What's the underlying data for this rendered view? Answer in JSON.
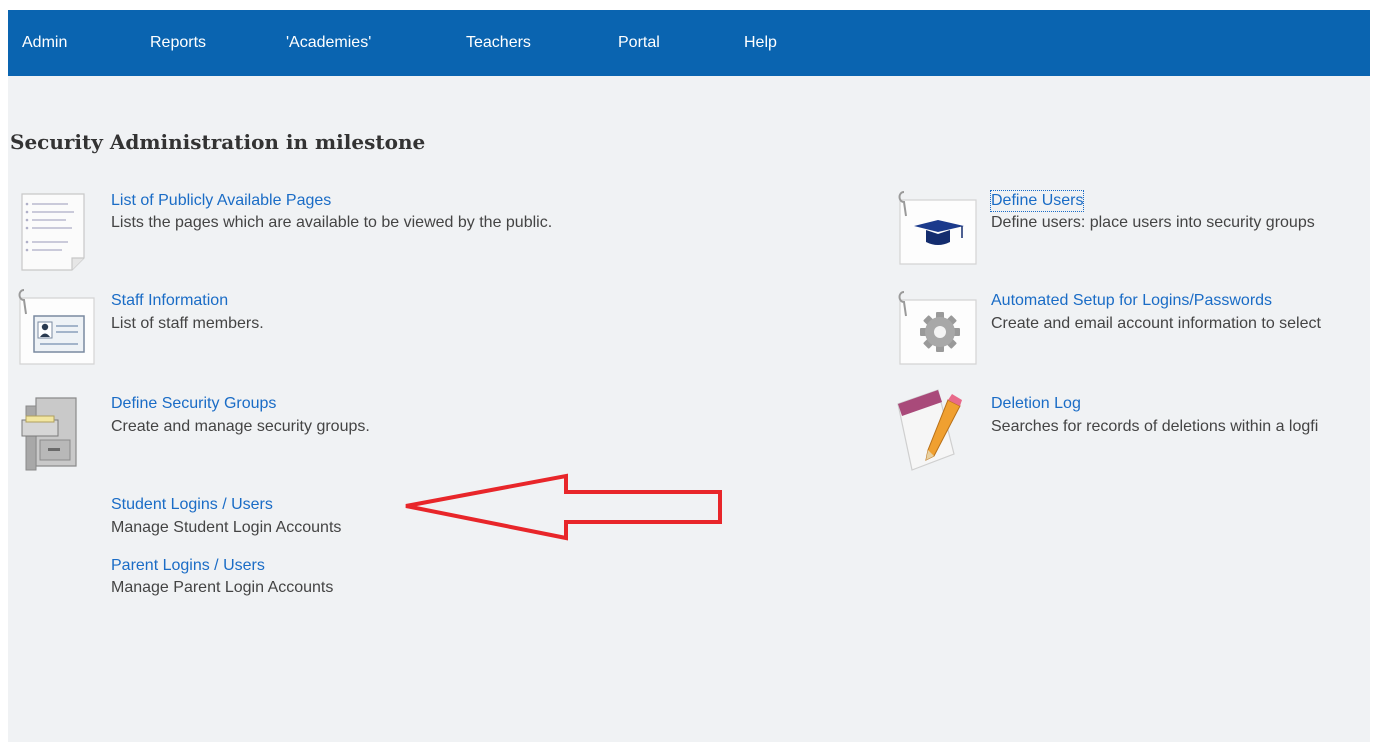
{
  "nav": {
    "items": [
      {
        "label": "Admin"
      },
      {
        "label": "Reports"
      },
      {
        "label": "'Academies'"
      },
      {
        "label": "Teachers"
      },
      {
        "label": "Portal"
      },
      {
        "label": "Help"
      }
    ]
  },
  "page": {
    "title": "Security Administration in milestone"
  },
  "entries": {
    "public_pages": {
      "label": "List of Publicly Available Pages",
      "description": "Lists the pages which are available to be viewed by the public.",
      "icon": "document-list-icon"
    },
    "staff_info": {
      "label": "Staff Information",
      "description": "List of staff members.",
      "icon": "staff-card-icon"
    },
    "security_groups": {
      "label": "Define Security Groups",
      "description": "Create and manage security groups.",
      "icon": "filing-cabinet-icon"
    },
    "student_logins": {
      "label": "Student Logins / Users",
      "description": "Manage Student Login Accounts"
    },
    "parent_logins": {
      "label": "Parent Logins / Users",
      "description": "Manage Parent Login Accounts"
    },
    "define_users": {
      "label": "Define Users",
      "description": "Define users: place users into security groups",
      "icon": "graduation-cap-icon"
    },
    "automated_setup": {
      "label": "Automated Setup for Logins/Passwords",
      "description": "Create and email account information to select",
      "icon": "gear-icon"
    },
    "deletion_log": {
      "label": "Deletion Log",
      "description": "Searches for records of deletions within a logfi",
      "icon": "notepad-pencil-icon"
    }
  },
  "annotation": {
    "arrow_color": "#e8262a"
  },
  "colors": {
    "nav_background": "#0a64b0",
    "link": "#1a6cc6",
    "page_background": "#f0f2f4"
  }
}
